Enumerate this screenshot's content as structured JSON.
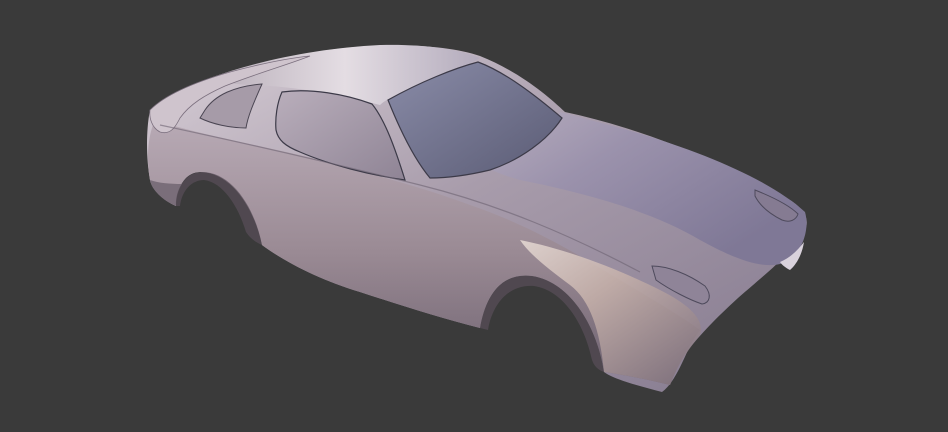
{
  "viewport": {
    "background_color": "#3a3a3a",
    "subject": "car-body-shell-3d-model",
    "material_colors": {
      "body_light": "#e6dfe4",
      "body_mid": "#a59aa6",
      "body_dark": "#6f6474",
      "glass": "#7a7c96",
      "glass_dark": "#55576e",
      "shadow": "#4a434d",
      "accent_warm": "#c9a58f"
    }
  }
}
